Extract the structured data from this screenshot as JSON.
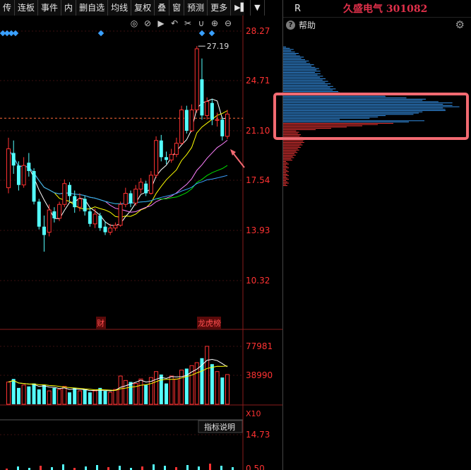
{
  "toolbar": {
    "items": [
      "传",
      "连板",
      "事件",
      "内",
      "删自选",
      "均线",
      "复权",
      "叠",
      "窗",
      "预测",
      "更多"
    ],
    "icons": [
      "skip-forward-icon",
      "dropdown-icon"
    ]
  },
  "chart_tools": [
    "eye-icon",
    "eye-slash-icon",
    "play-icon",
    "undo-icon",
    "scissors-icon",
    "magnet-icon",
    "zoom-in-icon",
    "zoom-out-icon"
  ],
  "price_axis": {
    "ticks": [
      "28.27",
      "24.71",
      "21.10",
      "17.54",
      "13.93",
      "10.32"
    ],
    "high_label": "27.19"
  },
  "volume_axis": {
    "ticks": [
      "77981",
      "38990"
    ],
    "unit": "X10"
  },
  "indicator": {
    "label": "指标说明",
    "ticks": [
      "14.73",
      "0.50"
    ]
  },
  "event_markers": [
    "财",
    "龙虎榜"
  ],
  "right_panel": {
    "r_label": "R",
    "stock_title": "久盛电气 301082",
    "help_label": "帮助"
  },
  "colors": {
    "up": "#ff3232",
    "down": "#54ffff",
    "ma5": "#ffffff",
    "ma10": "#ffff00",
    "ma20": "#ff80ff",
    "ma60": "#00e000",
    "ma120": "#3aa0ff",
    "highlight": "#f26a72"
  },
  "chart_data": {
    "type": "candlestick",
    "ylim": [
      10.32,
      28.27
    ],
    "candles": [
      {
        "o": 17.0,
        "c": 19.8,
        "h": 20.6,
        "l": 16.6
      },
      {
        "o": 19.5,
        "c": 18.6,
        "h": 20.4,
        "l": 18.0
      },
      {
        "o": 18.6,
        "c": 17.2,
        "h": 18.9,
        "l": 16.8
      },
      {
        "o": 17.2,
        "c": 18.6,
        "h": 19.2,
        "l": 17.0
      },
      {
        "o": 18.8,
        "c": 18.2,
        "h": 19.5,
        "l": 17.8
      },
      {
        "o": 18.2,
        "c": 16.0,
        "h": 18.4,
        "l": 15.8
      },
      {
        "o": 16.0,
        "c": 14.2,
        "h": 16.2,
        "l": 14.0
      },
      {
        "o": 14.2,
        "c": 13.6,
        "h": 15.0,
        "l": 12.4
      },
      {
        "o": 13.8,
        "c": 15.4,
        "h": 15.8,
        "l": 13.5
      },
      {
        "o": 15.3,
        "c": 14.8,
        "h": 15.6,
        "l": 14.5
      },
      {
        "o": 14.8,
        "c": 15.8,
        "h": 16.0,
        "l": 14.6
      },
      {
        "o": 15.8,
        "c": 17.3,
        "h": 17.6,
        "l": 15.6
      },
      {
        "o": 17.2,
        "c": 16.4,
        "h": 17.4,
        "l": 16.0
      },
      {
        "o": 16.4,
        "c": 15.6,
        "h": 16.8,
        "l": 15.2
      },
      {
        "o": 15.6,
        "c": 16.2,
        "h": 16.6,
        "l": 15.3
      },
      {
        "o": 16.2,
        "c": 15.3,
        "h": 16.4,
        "l": 15.0
      },
      {
        "o": 15.3,
        "c": 14.4,
        "h": 15.6,
        "l": 14.2
      },
      {
        "o": 14.4,
        "c": 15.1,
        "h": 15.5,
        "l": 14.1
      },
      {
        "o": 15.0,
        "c": 14.1,
        "h": 15.2,
        "l": 13.9
      },
      {
        "o": 14.2,
        "c": 13.8,
        "h": 14.6,
        "l": 13.6
      },
      {
        "o": 13.8,
        "c": 14.1,
        "h": 14.4,
        "l": 13.6
      },
      {
        "o": 14.1,
        "c": 14.3,
        "h": 14.5,
        "l": 13.9
      },
      {
        "o": 14.3,
        "c": 15.8,
        "h": 16.0,
        "l": 14.2
      },
      {
        "o": 15.8,
        "c": 16.6,
        "h": 17.0,
        "l": 15.6
      },
      {
        "o": 16.6,
        "c": 15.9,
        "h": 16.8,
        "l": 15.6
      },
      {
        "o": 15.9,
        "c": 16.9,
        "h": 17.2,
        "l": 15.7
      },
      {
        "o": 16.9,
        "c": 17.4,
        "h": 17.7,
        "l": 16.6
      },
      {
        "o": 17.3,
        "c": 16.6,
        "h": 17.5,
        "l": 16.4
      },
      {
        "o": 16.6,
        "c": 17.9,
        "h": 18.2,
        "l": 16.5
      },
      {
        "o": 17.9,
        "c": 20.4,
        "h": 20.7,
        "l": 17.7
      },
      {
        "o": 20.4,
        "c": 19.2,
        "h": 20.8,
        "l": 18.9
      },
      {
        "o": 19.2,
        "c": 19.0,
        "h": 19.6,
        "l": 18.7
      },
      {
        "o": 19.0,
        "c": 19.4,
        "h": 19.8,
        "l": 18.8
      },
      {
        "o": 19.4,
        "c": 20.2,
        "h": 20.6,
        "l": 19.2
      },
      {
        "o": 20.2,
        "c": 22.6,
        "h": 22.9,
        "l": 20.1
      },
      {
        "o": 22.6,
        "c": 21.1,
        "h": 22.9,
        "l": 20.9
      },
      {
        "o": 21.1,
        "c": 22.6,
        "h": 23.0,
        "l": 21.0
      },
      {
        "o": 22.6,
        "c": 27.0,
        "h": 27.19,
        "l": 22.4
      },
      {
        "o": 24.8,
        "c": 22.2,
        "h": 26.3,
        "l": 21.9
      },
      {
        "o": 22.2,
        "c": 23.2,
        "h": 23.5,
        "l": 21.9
      },
      {
        "o": 23.1,
        "c": 21.9,
        "h": 23.4,
        "l": 21.5
      },
      {
        "o": 21.9,
        "c": 21.9,
        "h": 22.4,
        "l": 21.4
      },
      {
        "o": 21.9,
        "c": 20.7,
        "h": 22.1,
        "l": 20.4
      },
      {
        "o": 20.7,
        "c": 22.3,
        "h": 22.6,
        "l": 20.5
      }
    ],
    "volume": [
      30,
      34,
      22,
      26,
      24,
      28,
      20,
      26,
      18,
      22,
      20,
      24,
      16,
      22,
      18,
      20,
      16,
      18,
      22,
      18,
      16,
      20,
      38,
      32,
      30,
      28,
      34,
      26,
      36,
      44,
      40,
      28,
      38,
      34,
      46,
      48,
      52,
      56,
      62,
      78,
      54,
      44,
      36,
      40
    ]
  }
}
